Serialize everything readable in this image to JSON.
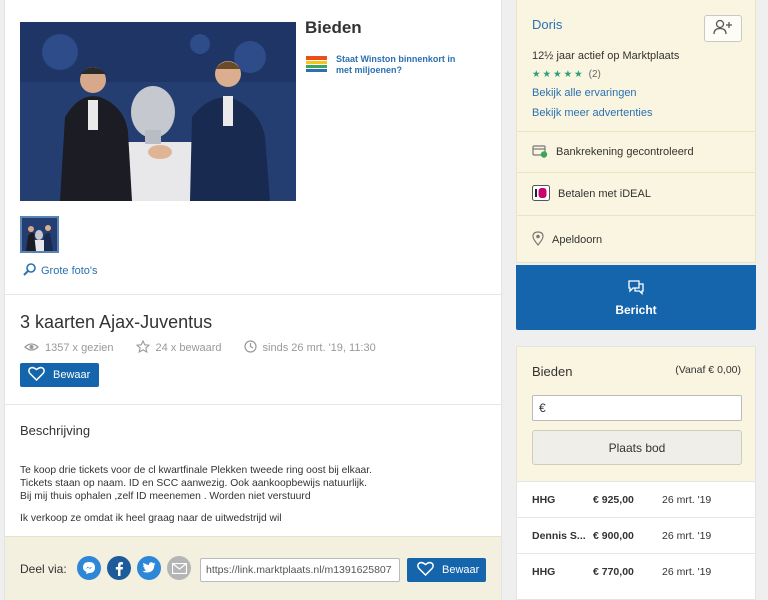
{
  "header": {
    "bieden_title": "Bieden"
  },
  "ad": {
    "text": "Staat Winston binnenkort in met miljoenen?"
  },
  "photos": {
    "grote_label": "Grote foto's"
  },
  "listing": {
    "title": "3 kaarten Ajax-Juventus",
    "views": "1357 x gezien",
    "saved": "24 x bewaard",
    "since": "sinds 26 mrt. '19, 11:30",
    "bewaar_label": "Bewaar"
  },
  "description": {
    "heading": "Beschrijving",
    "lines": [
      "Te koop drie tickets voor de cl kwartfinale Plekken tweede ring oost bij elkaar.",
      "Tickets staan op naam. ID en SCC aanwezig. Ook aankoopbewijs natuurlijk.",
      "Bij mij thuis ophalen ,zelf ID meenemen . Worden niet verstuurd",
      "Ik verkoop ze omdat ik heel graag naar de uitwedstrijd wil"
    ]
  },
  "share": {
    "label": "Deel via:",
    "link": "https://link.marktplaats.nl/m1391625807",
    "bewaar_label": "Bewaar"
  },
  "seller": {
    "name": "Doris",
    "years": "12½ jaar actief op Marktplaats",
    "rating_count": "(2)",
    "link_reviews": "Bekijk alle ervaringen",
    "link_ads": "Bekijk meer advertenties",
    "bank": "Bankrekening gecontroleerd",
    "ideal": "Betalen met iDEAL",
    "location": "Apeldoorn",
    "message_label": "Bericht"
  },
  "bidding": {
    "title": "Bieden",
    "from": "(Vanaf € 0,00)",
    "currency": "€",
    "place_label": "Plaats bod",
    "bids": [
      {
        "name": "HHG",
        "amount": "€ 925,00",
        "date": "26 mrt. '19"
      },
      {
        "name": "Dennis S...",
        "amount": "€ 900,00",
        "date": "26 mrt. '19"
      },
      {
        "name": "HHG",
        "amount": "€ 770,00",
        "date": "26 mrt. '19"
      }
    ]
  },
  "colors": {
    "primary_blue": "#1565ac",
    "link_blue": "#2b71b1",
    "seller_bg": "#f9f5e0",
    "star_green": "#2f9c7a"
  }
}
